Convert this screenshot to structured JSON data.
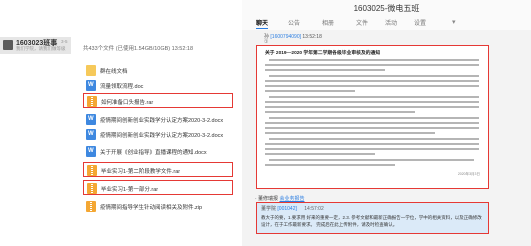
{
  "left": {
    "contact": {
      "name": "1603023班事",
      "subtitle": "我们学院，请我们做等级",
      "time": "3-5"
    },
    "files_header": "共433个文件 (已使用1.54GB/10GB)   13:52:18",
    "files": [
      {
        "icon": "folder-icon",
        "type": "folder",
        "name": "群在线文档",
        "highlighted": false
      },
      {
        "icon": "doc-icon",
        "type": "doc",
        "name": "流量领取流程.doc",
        "highlighted": false
      },
      {
        "icon": "rar-icon",
        "type": "rar",
        "name": "如何准备口头报告.rar",
        "highlighted": true
      },
      {
        "icon": "doc-icon",
        "type": "doc",
        "name": "疫情期间创新创业实践学分认定方案2020-3-2.docx",
        "highlighted": false
      },
      {
        "icon": "doc-icon",
        "type": "doc",
        "name": "疫情期间创新创业实践学分认定方案2020-3-2.docx",
        "highlighted": false
      },
      {
        "icon": "doc-icon",
        "type": "doc",
        "name": "关于开展《创业指导》直播课程的通知.docx",
        "highlighted": false
      },
      {
        "icon": "rar-icon",
        "type": "rar",
        "name": "毕业实习1-第二阶段教学文件.rar",
        "highlighted": true
      },
      {
        "icon": "rar-icon",
        "type": "rar",
        "name": "毕业实习1-第一部分.rar",
        "highlighted": true
      },
      {
        "icon": "rar-icon",
        "type": "rar",
        "name": "疫情期间指导学生针动阅读相关及附件.zip",
        "highlighted": false
      }
    ]
  },
  "right": {
    "window_title": "1603025-微电五班",
    "tabs": [
      "聊天",
      "公告",
      "相册",
      "文件",
      "活动",
      "设置"
    ],
    "active_tab": 0,
    "message": {
      "line1_prefix": "孙",
      "line1_link": "[1600794090]",
      "line1_time": "13:52:18",
      "line2": "①"
    },
    "document": {
      "title": "关于 2019—2020 学年第二学期各级毕业审核及的通知",
      "sign": "2020年3月3日"
    },
    "share": {
      "prefix": "· 董修瑞报",
      "link": "会业务报告"
    },
    "reply": {
      "name": "董学院",
      "id": "[001042]",
      "time": "14:57:02",
      "body": "教大于的要，1.要求用 好来的重要一定，2.3. 参考文献和最新正确报告一学位，学中的相关资料，以及正确修改设计，在于工作最新要求。 完成后在此上传附件，请及时检查确认。"
    }
  }
}
